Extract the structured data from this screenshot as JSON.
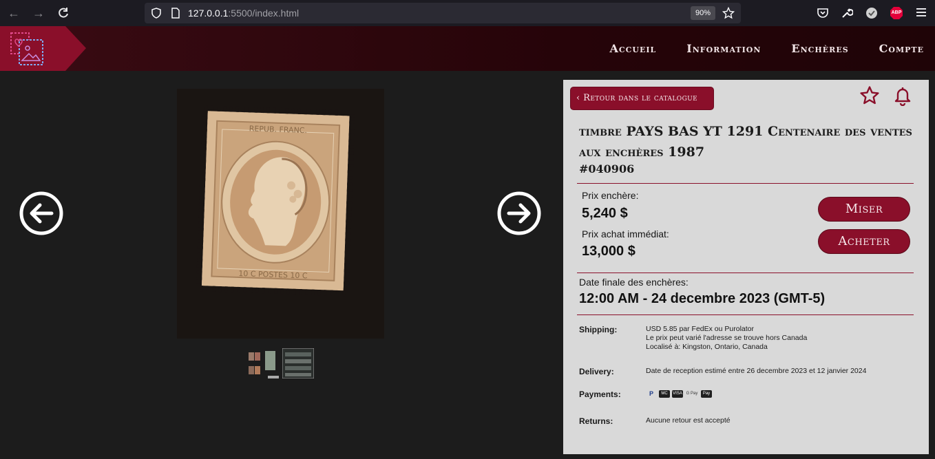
{
  "browser": {
    "url_host": "127.0.0.1",
    "url_path": ":5500/index.html",
    "zoom": "90%",
    "icons": [
      "back-arrow-icon",
      "forward-arrow-icon",
      "reload-icon",
      "shield-icon",
      "page-icon",
      "bookmark-star-icon",
      "pocket-icon",
      "wrench-icon",
      "extension-check-icon",
      "adblock-icon",
      "hamburger-menu-icon"
    ],
    "abp_label": "ABP"
  },
  "header": {
    "nav": [
      "Accueil",
      "Information",
      "Enchères",
      "Compte"
    ],
    "brand_color": "#8a0f2a"
  },
  "gallery": {
    "stamp_text_top": "REPUB. FRANC.",
    "stamp_text_bottom": "10 C POSTES 10 C"
  },
  "panel": {
    "back_label": "‹ Retour dans le catalogue",
    "title": "timbre PAYS BAS YT 1291 Centenaire des ventes aux enchères 1987",
    "lot_id": "#040906",
    "bid_label": "Prix enchère:",
    "bid_value": "5,240 $",
    "buy_label": "Prix achat immédiat:",
    "buy_value": "13,000 $",
    "bid_button": "Miser",
    "buy_button": "Acheter",
    "end_label": "Date finale des enchères:",
    "end_value": "12:00 AM - 24 decembre 2023 (GMT-5)",
    "shipping_label": "Shipping:",
    "shipping_lines": [
      "USD 5.85 par FedEx ou Purolator",
      "Le prix peut varié l'adresse se trouve hors Canada",
      "Localisé à: Kingston, Ontario, Canada"
    ],
    "delivery_label": "Delivery:",
    "delivery_text": "Date de reception estimé entre 26 decembre 2023 et 12 janvier 2024",
    "payments_label": "Payments:",
    "payment_methods": [
      "P",
      "MC",
      "VISA",
      "G Pay",
      "Pay"
    ],
    "returns_label": "Returns:",
    "returns_text": "Aucune retour est accepté"
  }
}
